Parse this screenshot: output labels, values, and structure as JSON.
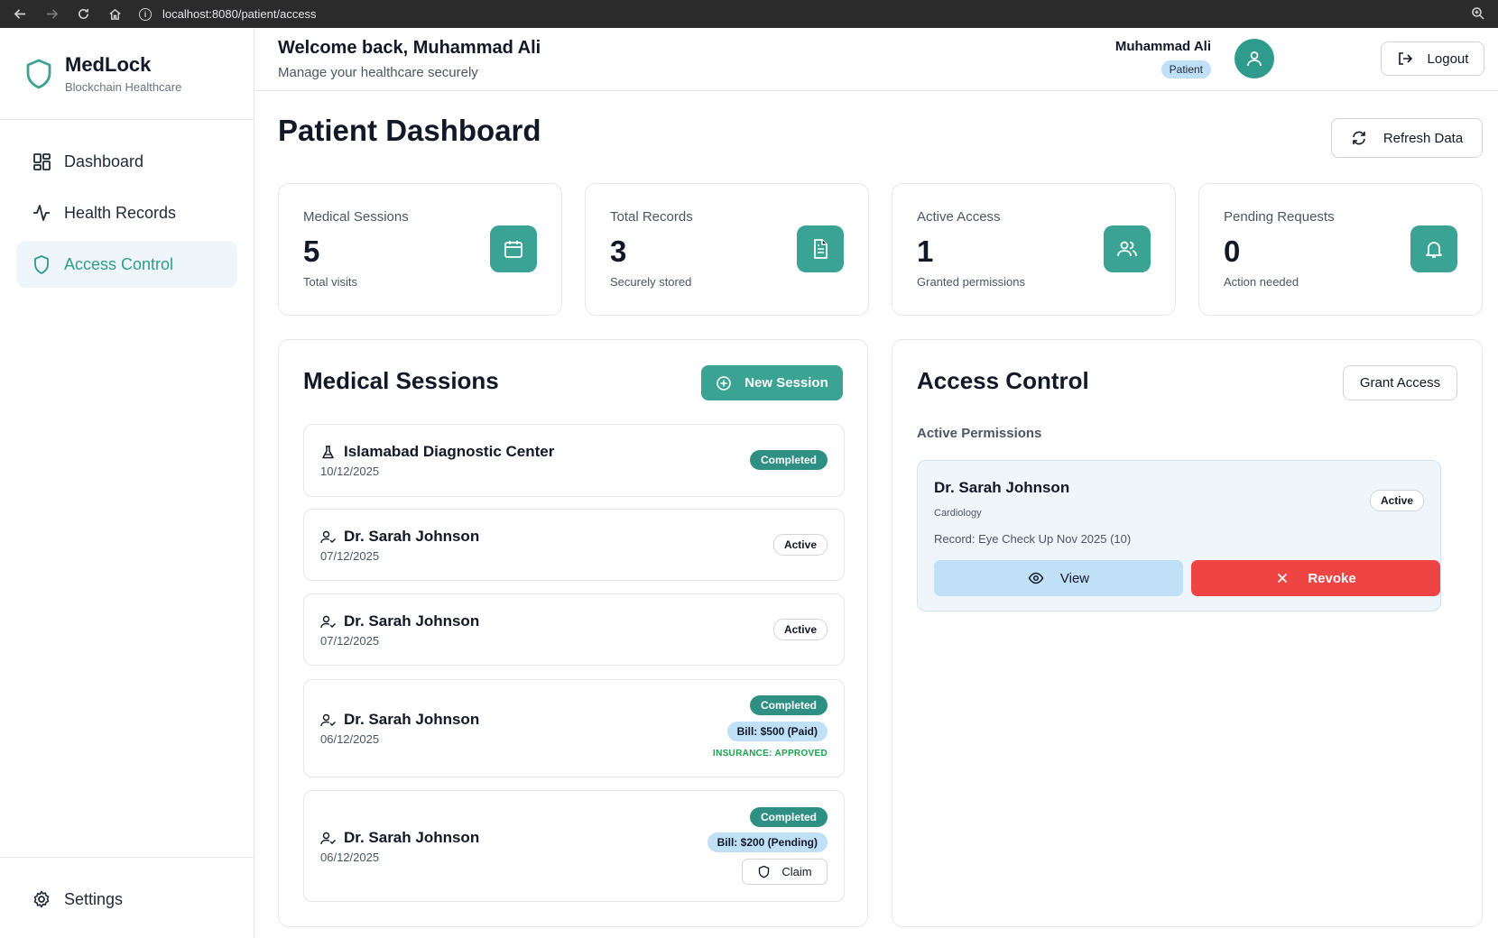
{
  "browser": {
    "url": "localhost:8080/patient/access"
  },
  "sidebar": {
    "brand_name": "MedLock",
    "brand_tagline": "Blockchain Healthcare",
    "items": [
      {
        "label": "Dashboard",
        "icon": "dashboard-grid-icon"
      },
      {
        "label": "Health Records",
        "icon": "activity-pulse-icon"
      },
      {
        "label": "Access Control",
        "icon": "shield-icon",
        "active": true
      }
    ],
    "settings_label": "Settings"
  },
  "header": {
    "welcome": "Welcome back, Muhammad Ali",
    "subtitle": "Manage your healthcare securely",
    "user_name": "Muhammad Ali",
    "role": "Patient",
    "logout_label": "Logout"
  },
  "main": {
    "title": "Patient Dashboard",
    "refresh_label": "Refresh Data",
    "stats": [
      {
        "label": "Medical Sessions",
        "value": "5",
        "sub": "Total visits",
        "icon": "calendar-icon"
      },
      {
        "label": "Total Records",
        "value": "3",
        "sub": "Securely stored",
        "icon": "document-icon"
      },
      {
        "label": "Active Access",
        "value": "1",
        "sub": "Granted permissions",
        "icon": "users-icon"
      },
      {
        "label": "Pending Requests",
        "value": "0",
        "sub": "Action needed",
        "icon": "bell-icon"
      }
    ]
  },
  "sessions": {
    "title": "Medical Sessions",
    "new_label": "New Session",
    "items": [
      {
        "name": "Islamabad Diagnostic Center",
        "date": "10/12/2025",
        "status": "Completed",
        "icon": "flask-icon"
      },
      {
        "name": "Dr. Sarah Johnson",
        "date": "07/12/2025",
        "status": "Active",
        "icon": "user-check-icon"
      },
      {
        "name": "Dr. Sarah Johnson",
        "date": "07/12/2025",
        "status": "Active",
        "icon": "user-check-icon"
      },
      {
        "name": "Dr. Sarah Johnson",
        "date": "06/12/2025",
        "status": "Completed",
        "bill": "Bill: $500 (Paid)",
        "insurance": "INSURANCE: APPROVED",
        "icon": "user-check-icon"
      },
      {
        "name": "Dr. Sarah Johnson",
        "date": "06/12/2025",
        "status": "Completed",
        "bill": "Bill: $200 (Pending)",
        "claim_label": "Claim",
        "icon": "user-check-icon"
      }
    ]
  },
  "access": {
    "title": "Access Control",
    "grant_label": "Grant Access",
    "section_label": "Active Permissions",
    "permission": {
      "doctor": "Dr. Sarah Johnson",
      "specialty": "Cardiology",
      "record": "Record: Eye Check Up Nov 2025 (10)",
      "status": "Active",
      "view_label": "View",
      "revoke_label": "Revoke"
    }
  },
  "colors": {
    "primary": "#3aa394",
    "primary_dark": "#2f8f83",
    "active_bg": "#eef6fc",
    "light_blue": "#bfe0f7",
    "danger": "#ef4444",
    "success_text": "#16a34a"
  }
}
